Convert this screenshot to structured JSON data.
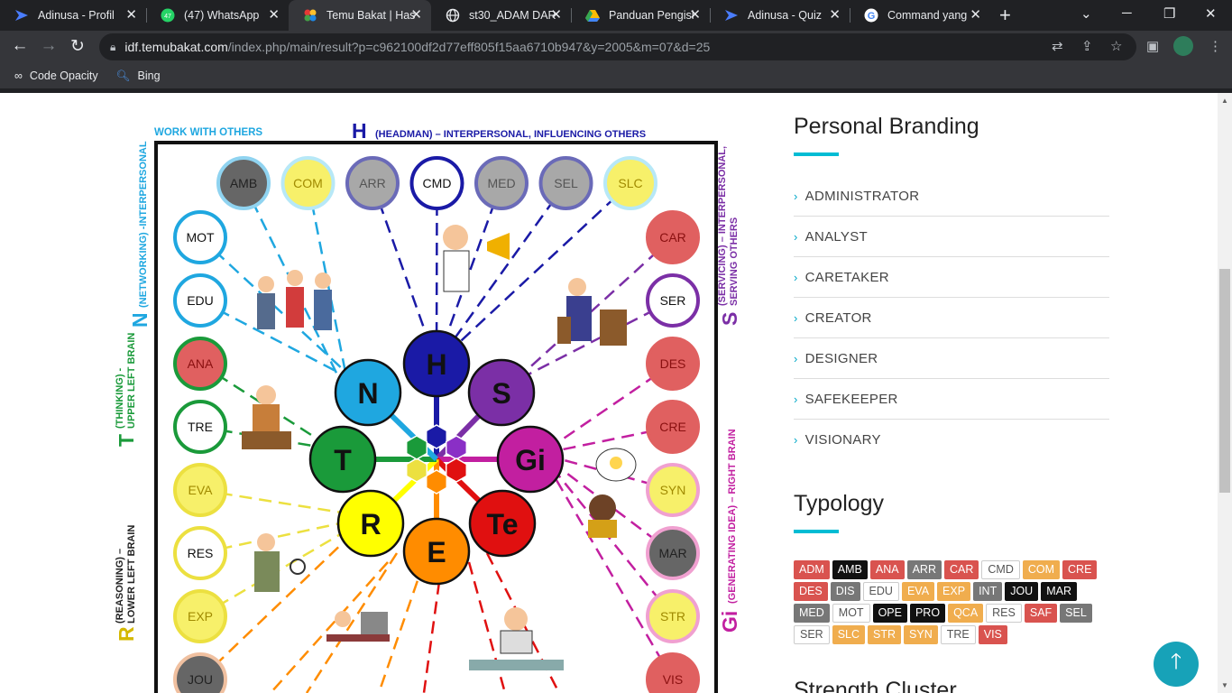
{
  "browser": {
    "tabs": [
      {
        "title": "Adinusa - Profil",
        "icon": "adinusa-icon"
      },
      {
        "title": "(47) WhatsApp",
        "icon": "whatsapp-icon"
      },
      {
        "title": "Temu Bakat | Has",
        "icon": "temubakat-icon"
      },
      {
        "title": "st30_ADAM DAR",
        "icon": "globe-icon"
      },
      {
        "title": "Panduan Pengisi",
        "icon": "drive-icon"
      },
      {
        "title": "Adinusa - Quiz",
        "icon": "adinusa-icon"
      },
      {
        "title": "Command yang",
        "icon": "google-icon"
      }
    ],
    "whatsapp_badge": "47",
    "url_host": "idf.temubakat.com",
    "url_rest": "/index.php/main/result?p=c962100df2d77eff805f15aa6710b947&y=2005&m=07&d=25",
    "bookmarks": [
      {
        "label": "Code Opacity",
        "icon": "code-opacity-icon"
      },
      {
        "label": "Bing",
        "icon": "bing-search-icon"
      }
    ]
  },
  "diagram": {
    "top_left_label": "WORK WITH OTHERS",
    "top_label_letter": "H",
    "top_label_text": "(HEADMAN) – INTERPERSONAL, INFLUENCING OTHERS",
    "left_n_letter": "N",
    "left_n_text": "(NETWORKING) -INTERPERSONAL",
    "left_t_letter": "T",
    "left_t_text1": "(THINKING) -",
    "left_t_text2": "UPPER LEFT BRAIN",
    "left_r_letter": "R",
    "left_r_text1": "(REASONING) –",
    "left_r_text2": "LOWER LEFT BRAIN",
    "right_s_letter": "S",
    "right_s_text1": "(SERVICING) – INTERPERSONAL,",
    "right_s_text2": "SERVING OTHERS",
    "right_gi_letter": "Gi",
    "right_gi_text": "(GENERATING IDEA) – RIGHT BRAIN",
    "top_circles": [
      "AMB",
      "COM",
      "ARR",
      "CMD",
      "MED",
      "SEL",
      "SLC"
    ],
    "left_circles": [
      "MOT",
      "EDU",
      "ANA",
      "TRE",
      "EVA",
      "RES",
      "EXP",
      "JOU"
    ],
    "right_circles": [
      "CAR",
      "SER",
      "DES",
      "CRE",
      "SYN",
      "MAR",
      "STR",
      "VIS"
    ],
    "center_circles": [
      "H",
      "S",
      "Gi",
      "Te",
      "E",
      "R",
      "T",
      "N"
    ]
  },
  "sidebar": {
    "branding_title": "Personal Branding",
    "branding_items": [
      "ADMINISTRATOR",
      "ANALYST",
      "CARETAKER",
      "CREATOR",
      "DESIGNER",
      "SAFEKEEPER",
      "VISIONARY"
    ],
    "typology_title": "Typology",
    "typology_tags": [
      {
        "code": "ADM",
        "color": "r"
      },
      {
        "code": "AMB",
        "color": "k"
      },
      {
        "code": "ANA",
        "color": "r"
      },
      {
        "code": "ARR",
        "color": "g"
      },
      {
        "code": "CAR",
        "color": "r"
      },
      {
        "code": "CMD",
        "color": "w"
      },
      {
        "code": "COM",
        "color": "o"
      },
      {
        "code": "CRE",
        "color": "r"
      },
      {
        "code": "DES",
        "color": "r"
      },
      {
        "code": "DIS",
        "color": "g"
      },
      {
        "code": "EDU",
        "color": "w"
      },
      {
        "code": "EVA",
        "color": "o"
      },
      {
        "code": "EXP",
        "color": "o"
      },
      {
        "code": "INT",
        "color": "g"
      },
      {
        "code": "JOU",
        "color": "k"
      },
      {
        "code": "MAR",
        "color": "k"
      },
      {
        "code": "MED",
        "color": "g"
      },
      {
        "code": "MOT",
        "color": "w"
      },
      {
        "code": "OPE",
        "color": "k"
      },
      {
        "code": "PRO",
        "color": "k"
      },
      {
        "code": "QCA",
        "color": "o"
      },
      {
        "code": "RES",
        "color": "w"
      },
      {
        "code": "SAF",
        "color": "r"
      },
      {
        "code": "SEL",
        "color": "g"
      },
      {
        "code": "SER",
        "color": "w"
      },
      {
        "code": "SLC",
        "color": "o"
      },
      {
        "code": "STR",
        "color": "o"
      },
      {
        "code": "SYN",
        "color": "o"
      },
      {
        "code": "TRE",
        "color": "w"
      },
      {
        "code": "VIS",
        "color": "r"
      }
    ],
    "next_title": "Strength Cluster"
  },
  "colors": {
    "accent": "#00bcd4",
    "fab": "#17a2b8"
  }
}
